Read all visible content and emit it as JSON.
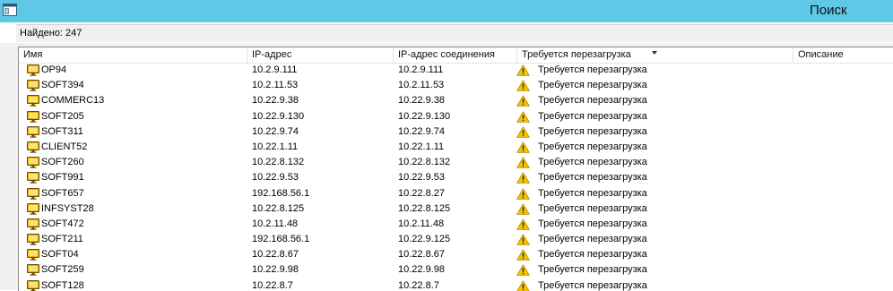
{
  "window": {
    "title": "Поиск"
  },
  "found": {
    "label": "Найдено: 247"
  },
  "columns": [
    "Имя",
    "IP-адрес",
    "IP-адрес соединения",
    "Требуется перезагрузка",
    "Описание"
  ],
  "rows": [
    {
      "name": "OP94",
      "ip": "10.2.9.111",
      "conn": "10.2.9.111",
      "status": "Требуется перезагрузка"
    },
    {
      "name": "SOFT394",
      "ip": "10.2.11.53",
      "conn": "10.2.11.53",
      "status": "Требуется перезагрузка"
    },
    {
      "name": "COMMERC13",
      "ip": "10.22.9.38",
      "conn": "10.22.9.38",
      "status": "Требуется перезагрузка"
    },
    {
      "name": "SOFT205",
      "ip": "10.22.9.130",
      "conn": "10.22.9.130",
      "status": "Требуется перезагрузка"
    },
    {
      "name": "SOFT311",
      "ip": "10.22.9.74",
      "conn": "10.22.9.74",
      "status": "Требуется перезагрузка"
    },
    {
      "name": "CLIENT52",
      "ip": "10.22.1.11",
      "conn": "10.22.1.11",
      "status": "Требуется перезагрузка"
    },
    {
      "name": "SOFT260",
      "ip": "10.22.8.132",
      "conn": "10.22.8.132",
      "status": "Требуется перезагрузка"
    },
    {
      "name": "SOFT991",
      "ip": "10.22.9.53",
      "conn": "10.22.9.53",
      "status": "Требуется перезагрузка"
    },
    {
      "name": "SOFT657",
      "ip": "192.168.56.1",
      "conn": "10.22.8.27",
      "status": "Требуется перезагрузка"
    },
    {
      "name": "INFSYST28",
      "ip": "10.22.8.125",
      "conn": "10.22.8.125",
      "status": "Требуется перезагрузка"
    },
    {
      "name": "SOFT472",
      "ip": "10.2.11.48",
      "conn": "10.2.11.48",
      "status": "Требуется перезагрузка"
    },
    {
      "name": "SOFT211",
      "ip": "192.168.56.1",
      "conn": "10.22.9.125",
      "status": "Требуется перезагрузка"
    },
    {
      "name": "SOFT04",
      "ip": "10.22.8.67",
      "conn": "10.22.8.67",
      "status": "Требуется перезагрузка"
    },
    {
      "name": "SOFT259",
      "ip": "10.22.9.98",
      "conn": "10.22.9.98",
      "status": "Требуется перезагрузка"
    },
    {
      "name": "SOFT128",
      "ip": "10.22.8.7",
      "conn": "10.22.8.7",
      "status": "Требуется перезагрузка"
    }
  ],
  "icons": {
    "row": "computer-icon",
    "status": "warning-icon",
    "window": "window-icon",
    "sort": "sort-descending-icon"
  },
  "colors": {
    "titlebar": "#5ec8e6",
    "warning": "#f3c400",
    "monitor": "#e8b000"
  }
}
